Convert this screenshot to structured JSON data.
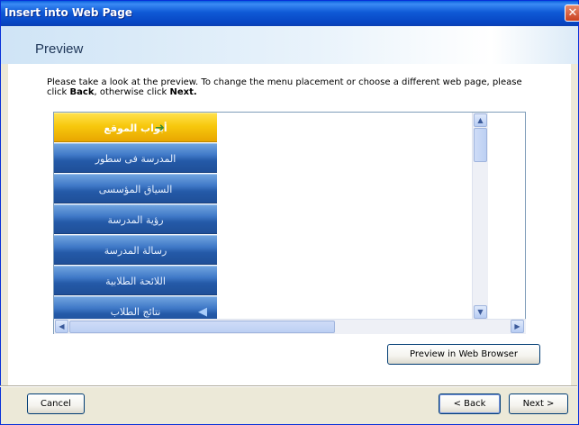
{
  "window": {
    "title": "Insert into Web Page",
    "close_label": "✕"
  },
  "header": {
    "page_title": "Preview"
  },
  "instructions": {
    "part1": "Please take a look at the preview. To change the menu placement or choose a different web page, please click ",
    "back_word": "Back",
    "part2": ", otherwise click ",
    "next_word": "Next."
  },
  "preview": {
    "menu_header": "أبواب الموقع",
    "menu_items": [
      "المدرسة فى سطور",
      "السياق المؤسسى",
      "رؤية المدرسة",
      "رسالة المدرسة",
      "اللائحة الطلابية",
      "نتائج الطلاب"
    ]
  },
  "buttons": {
    "preview_in_browser": "Preview in Web Browser",
    "cancel": "Cancel",
    "back": "< Back",
    "next": "Next >"
  },
  "colors": {
    "titlebar": "#0a5fdc",
    "menu_header": "#f7c80d",
    "menu_item": "#3f78c7"
  }
}
